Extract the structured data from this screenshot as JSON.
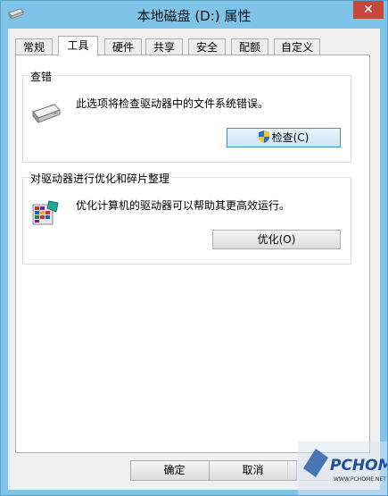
{
  "window": {
    "title": "本地磁盘 (D:) 属性",
    "close_glyph": "✕"
  },
  "tabs": [
    {
      "label": "常规",
      "active": false
    },
    {
      "label": "工具",
      "active": true
    },
    {
      "label": "硬件",
      "active": false
    },
    {
      "label": "共享",
      "active": false
    },
    {
      "label": "安全",
      "active": false
    },
    {
      "label": "配额",
      "active": false
    },
    {
      "label": "自定义",
      "active": false
    }
  ],
  "check_group": {
    "title": "查错",
    "description": "此选项将检查驱动器中的文件系统错误。",
    "button_label": "检查(C)",
    "icon": "drive-icon"
  },
  "optimize_group": {
    "title": "对驱动器进行优化和碎片整理",
    "description": "优化计算机的驱动器可以帮助其更高效运行。",
    "button_label": "优化(O)",
    "icon": "defrag-icon"
  },
  "footer": {
    "ok_label": "确定",
    "cancel_label": "取消"
  },
  "watermark": {
    "brand": "PCHOME",
    "url": "WWW.PCHOME.NET"
  },
  "colors": {
    "frame": "#7fc3e9",
    "close": "#c7473f",
    "focus_border": "#4a8ac4"
  }
}
